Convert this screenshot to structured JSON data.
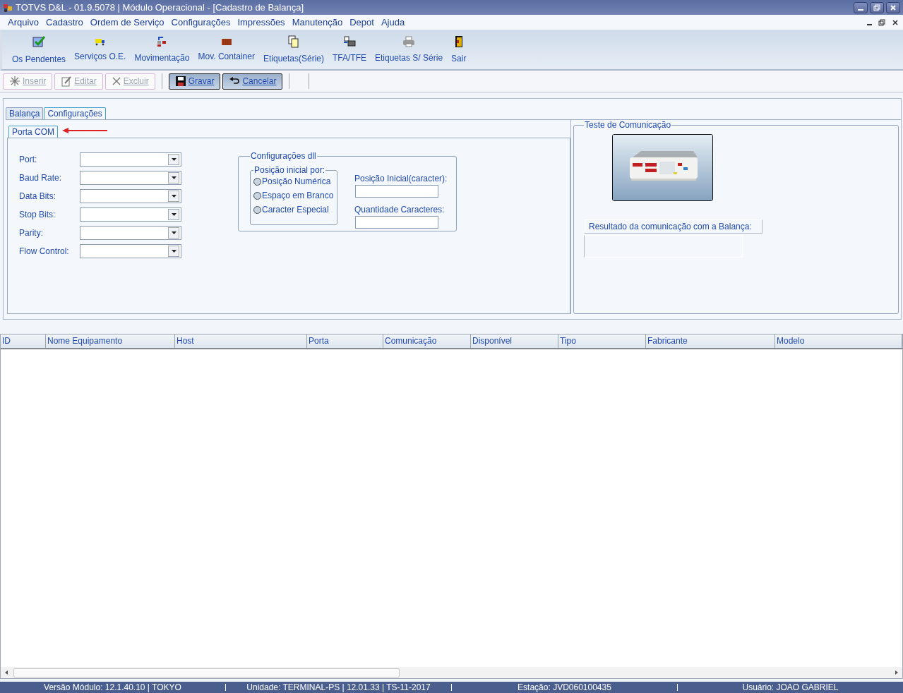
{
  "window": {
    "title": "TOTVS D&L - 01.9.5078 | Módulo Operacional - [Cadastro de Balança]"
  },
  "menu": [
    "Arquivo",
    "Cadastro",
    "Ordem de Serviço",
    "Configurações",
    "Impressões",
    "Manutenção",
    "Depot",
    "Ajuda"
  ],
  "toolbar": [
    {
      "label": "Os Pendentes",
      "kind": "check"
    },
    {
      "label": "Serviços O.E.",
      "kind": "truck"
    },
    {
      "label": "Movimentação",
      "kind": "move"
    },
    {
      "label": "Mov. Container",
      "kind": "container"
    },
    {
      "label": "Etiquetas(Série)",
      "kind": "pages"
    },
    {
      "label": "TFA/TFE",
      "kind": "transfer"
    },
    {
      "label": "Etiquetas S/ Série",
      "kind": "printer"
    },
    {
      "label": "Sair",
      "kind": "door"
    }
  ],
  "actions": [
    {
      "label": "Inserir",
      "kind": "insert",
      "disabled": true
    },
    {
      "label": "Editar",
      "kind": "edit",
      "disabled": true
    },
    {
      "label": "Excluir",
      "kind": "delete",
      "disabled": true
    },
    {
      "label": "Gravar",
      "kind": "save",
      "disabled": false
    },
    {
      "label": "Cancelar",
      "kind": "undo",
      "disabled": false
    }
  ],
  "tabs": [
    {
      "label": "Balança",
      "selected": false
    },
    {
      "label": "Configurações",
      "selected": true
    }
  ],
  "subtabs": [
    {
      "label": "Porta COM",
      "selected": true
    }
  ],
  "serial_fields": [
    {
      "label": "Port:"
    },
    {
      "label": "Baud Rate:"
    },
    {
      "label": "Data Bits:"
    },
    {
      "label": "Stop Bits:"
    },
    {
      "label": "Parity:"
    },
    {
      "label": "Flow Control:"
    }
  ],
  "dll_group": {
    "title": "Configurações dll",
    "radio_group": {
      "title": "Posição inicial por:",
      "options": [
        {
          "label": "Posição Numérica",
          "selected": false
        },
        {
          "label": "Espaço em Branco",
          "selected": false
        },
        {
          "label": "Caracter Especial",
          "selected": false
        }
      ]
    },
    "fields": [
      {
        "label": "Posição Inicial(caracter):"
      },
      {
        "label": "Quantidade Caracteres:"
      }
    ]
  },
  "test_group": {
    "title": "Teste de Comunicação",
    "result_label": "Resultado da comunicação com a Balança:"
  },
  "table": {
    "columns": [
      "ID",
      "Nome Equipamento",
      "Host",
      "Porta",
      "Comunicação",
      "Disponível",
      "Tipo",
      "Fabricante",
      "Modelo"
    ]
  },
  "status_bar": [
    "Versão Módulo:  12.1.40.10  |  TOKYO",
    "Unidade: TERMINAL-PS | 12.01.33 | TS-11-2017",
    "Estação: JVD060100435",
    "Usuário: JOAO GABRIEL"
  ]
}
